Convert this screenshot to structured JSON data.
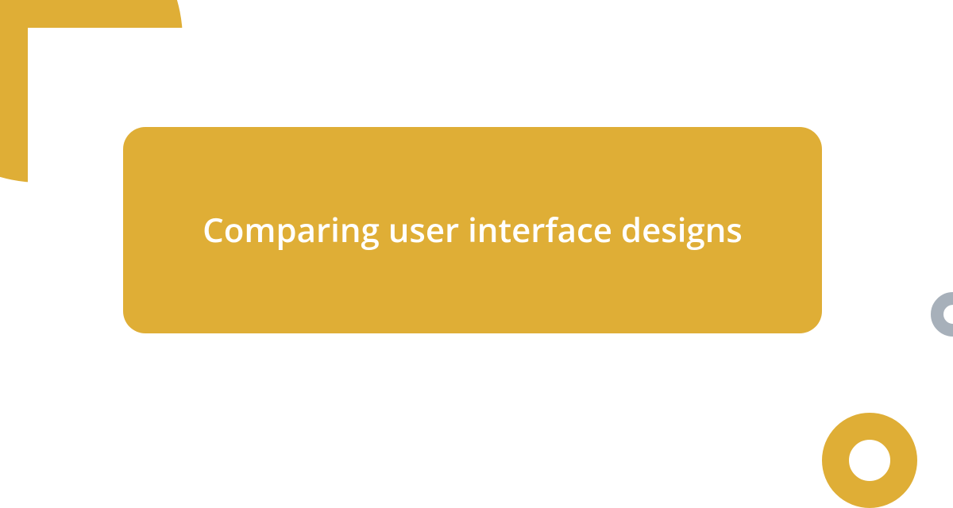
{
  "title": "Comparing user interface designs",
  "colors": {
    "accent": "#dfae36",
    "grey": "#a7b0ba",
    "background": "#ffffff",
    "text": "#ffffff"
  }
}
